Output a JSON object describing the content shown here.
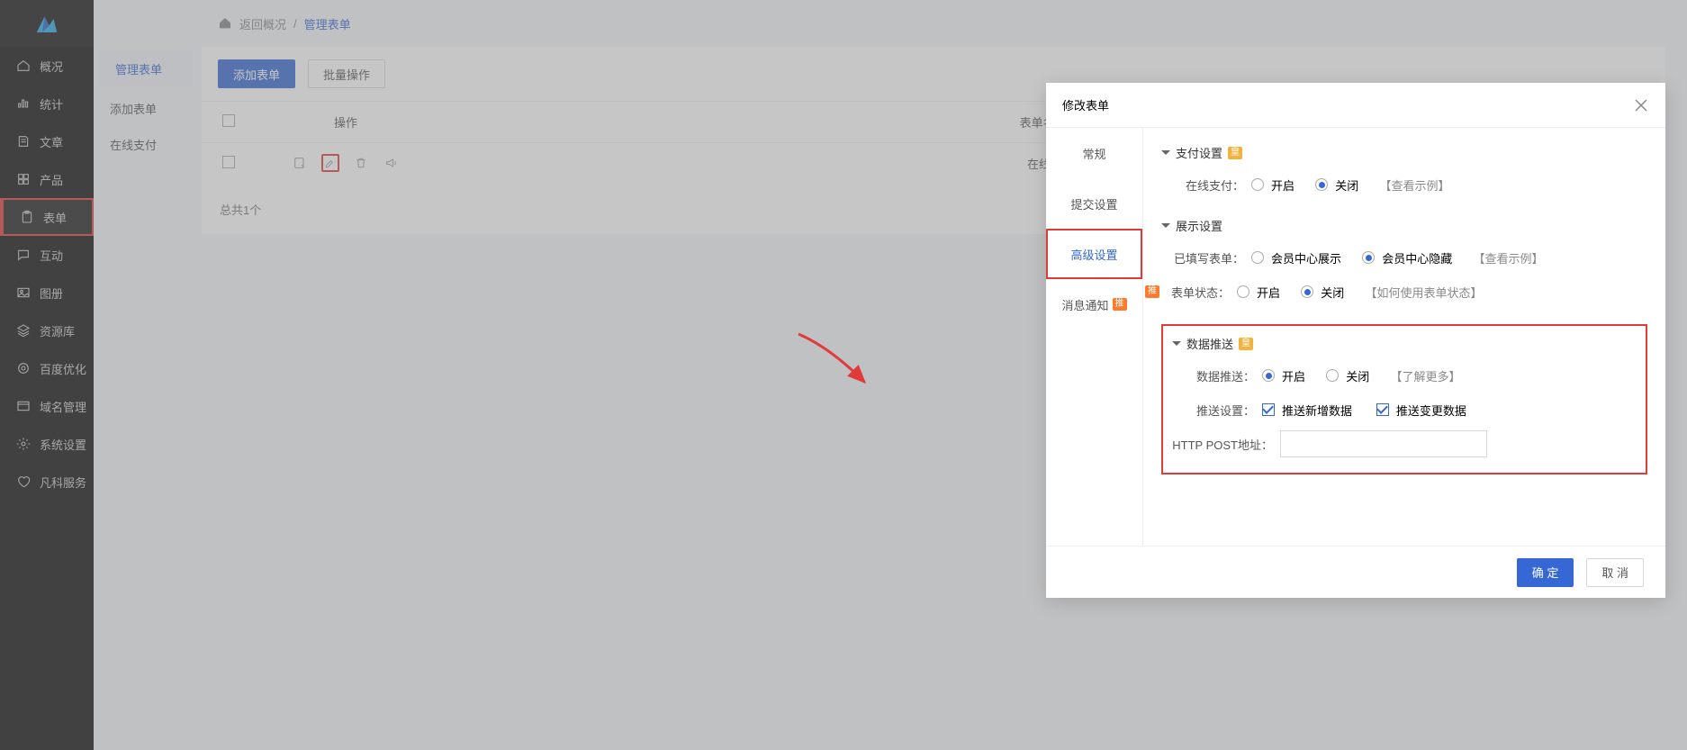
{
  "rail": [
    {
      "icon": "home",
      "label": "概况"
    },
    {
      "icon": "stats",
      "label": "统计"
    },
    {
      "icon": "doc",
      "label": "文章"
    },
    {
      "icon": "grid",
      "label": "产品"
    },
    {
      "icon": "clipboard",
      "label": "表单"
    },
    {
      "icon": "chat",
      "label": "互动"
    },
    {
      "icon": "img",
      "label": "图册"
    },
    {
      "icon": "layers",
      "label": "资源库"
    },
    {
      "icon": "target",
      "label": "百度优化"
    },
    {
      "icon": "www",
      "label": "域名管理"
    },
    {
      "icon": "gear",
      "label": "系统设置"
    },
    {
      "icon": "heart",
      "label": "凡科服务"
    }
  ],
  "rail_active_index": 4,
  "submenu": {
    "items": [
      "管理表单",
      "添加表单",
      "在线支付"
    ],
    "active_index": 0
  },
  "breadcrumb": {
    "back": "返回概况",
    "sep": "/",
    "current": "管理表单"
  },
  "toolbar": {
    "add": "添加表单",
    "batch": "批量操作"
  },
  "table": {
    "col_ops": "操作",
    "col_name": "表单名称",
    "row_name": "在线询价",
    "footer": "总共1个"
  },
  "modal": {
    "title": "修改表单",
    "tabs": [
      "常规",
      "提交设置",
      "高级设置",
      "消息通知"
    ],
    "tabs_tag_index": 3,
    "tabs_tag": "推",
    "active_tab_index": 2,
    "pay_section": "支付设置",
    "pay_label": "在线支付：",
    "on": "开启",
    "off": "关闭",
    "pay_example": "【查看示例】",
    "show_section": "展示设置",
    "filled_label": "已填写表单：",
    "filled_opt_show": "会员中心展示",
    "filled_opt_hide": "会员中心隐藏",
    "filled_example": "【查看示例】",
    "status_label": "表单状态：",
    "status_how": "【如何使用表单状态】",
    "push_section": "数据推送",
    "push_label": "数据推送：",
    "push_more": "【了解更多】",
    "push_setting_label": "推送设置：",
    "push_new": "推送新增数据",
    "push_change": "推送变更数据",
    "post_label": "HTTP POST地址：",
    "ok": "确 定",
    "cancel": "取 消"
  }
}
